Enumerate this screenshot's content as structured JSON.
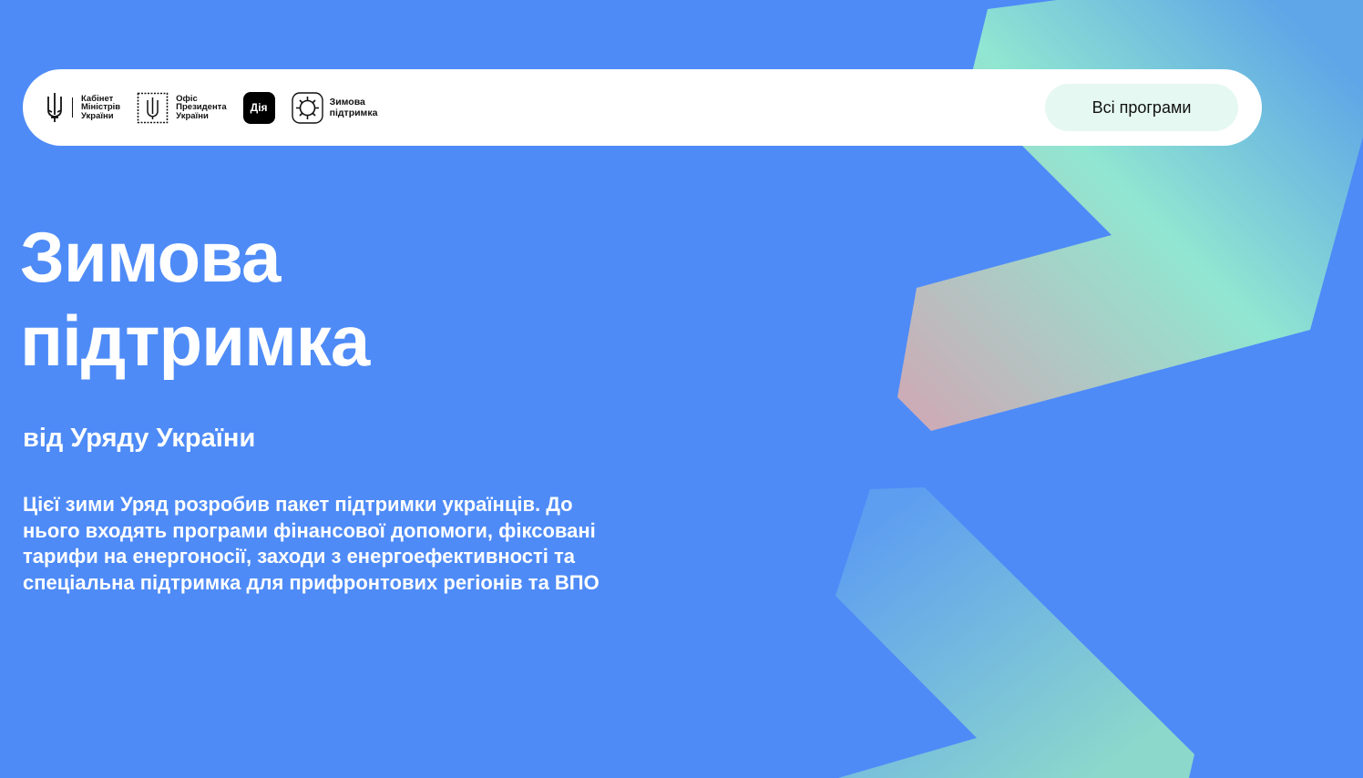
{
  "colors": {
    "background": "#4e8bf7",
    "header_bg": "#ffffff",
    "button_bg": "#e5f8f1",
    "accent_mint": "#94ebcf",
    "accent_pink": "#d2aeb3"
  },
  "header": {
    "logos": [
      {
        "icon": "trident-icon",
        "text": "Кабінет\nМіністрів\nУкраїни"
      },
      {
        "icon": "stamp-icon",
        "text": "Офіс\nПрезидента\nУкраїни"
      },
      {
        "icon": "diia-icon",
        "text": "Дія"
      },
      {
        "icon": "snowflake-icon",
        "text": "Зимова\nпідтримка"
      }
    ],
    "all_programs_label": "Всі програми"
  },
  "hero": {
    "title": "Зимова підтримка",
    "subtitle": "від Уряду України",
    "description": "Цієї зими Уряд розробив пакет підтримки українців. До нього входять програми фінансової допомоги, фіксовані тарифи на енергоносії, заходи з енергоефективності та спеціальна підтримка для прифронтових регіонів та ВПО"
  }
}
